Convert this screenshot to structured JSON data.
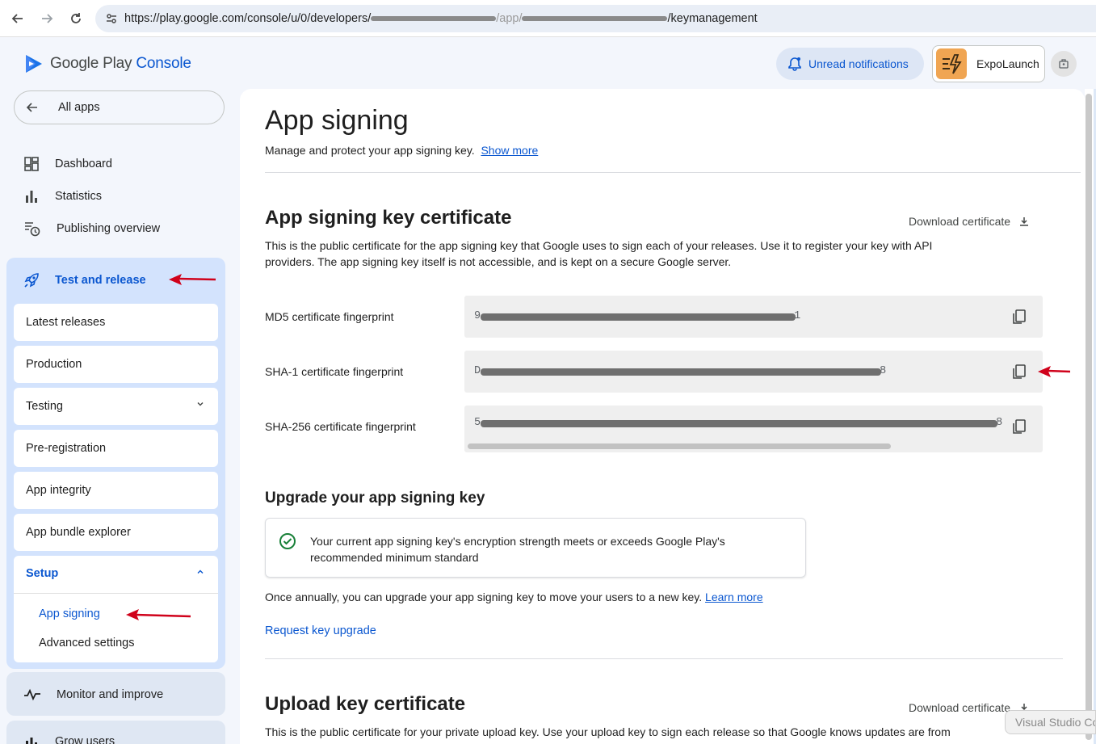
{
  "browser": {
    "url_prefix": "https://play.google.com/console/u/0/developers/",
    "url_mid": "/app/",
    "url_suffix": "/keymanagement"
  },
  "header": {
    "logo_google_play": "Google Play",
    "logo_console": "Console",
    "notifications_label": "Unread notifications",
    "app_name": "ExpoLaunch"
  },
  "sidebar": {
    "all_apps": "All apps",
    "items": [
      {
        "label": "Dashboard",
        "icon": "dashboard-icon"
      },
      {
        "label": "Statistics",
        "icon": "bar-chart-icon"
      },
      {
        "label": "Publishing overview",
        "icon": "publishing-history-icon"
      }
    ],
    "test_and_release": {
      "label": "Test and release",
      "icon": "rocket-icon",
      "children": [
        "Latest releases",
        "Production",
        "Testing",
        "Pre-registration",
        "App integrity",
        "App bundle explorer"
      ],
      "setup": {
        "label": "Setup",
        "links": [
          "App signing",
          "Advanced settings"
        ],
        "active": "App signing"
      }
    },
    "monitor": "Monitor and improve",
    "grow": "Grow users"
  },
  "main": {
    "title": "App signing",
    "subtitle": "Manage and protect your app signing key.",
    "show_more": "Show more",
    "signing_cert": {
      "title": "App signing key certificate",
      "download": "Download certificate",
      "description": "This is the public certificate for the app signing key that Google uses to sign each of your releases. Use it to register your key with API providers. The app signing key itself is not accessible, and is kept on a secure Google server.",
      "fingerprints": [
        {
          "label": "MD5 certificate fingerprint",
          "value_start": "9",
          "value_end": "1"
        },
        {
          "label": "SHA-1 certificate fingerprint",
          "value_start": "D",
          "value_end": "8"
        },
        {
          "label": "SHA-256 certificate fingerprint",
          "value_start": "5",
          "value_end": "8"
        }
      ]
    },
    "upgrade": {
      "title": "Upgrade your app signing key",
      "status": "Your current app signing key's encryption strength meets or exceeds Google Play's recommended minimum standard",
      "annual_note": "Once annually, you can upgrade your app signing key to move your users to a new key.",
      "learn_more": "Learn more",
      "request": "Request key upgrade"
    },
    "upload_cert": {
      "title": "Upload key certificate",
      "download": "Download certificate",
      "description": "This is the public certificate for your private upload key. Use your upload key to sign each release so that Google knows updates are from"
    }
  },
  "overlay": {
    "vscode": "Visual Studio Co"
  },
  "colors": {
    "accent": "#0b57d0",
    "nav_active_bg": "#d3e3fd",
    "annotation_arrow": "#d0021b",
    "success": "#188038"
  }
}
